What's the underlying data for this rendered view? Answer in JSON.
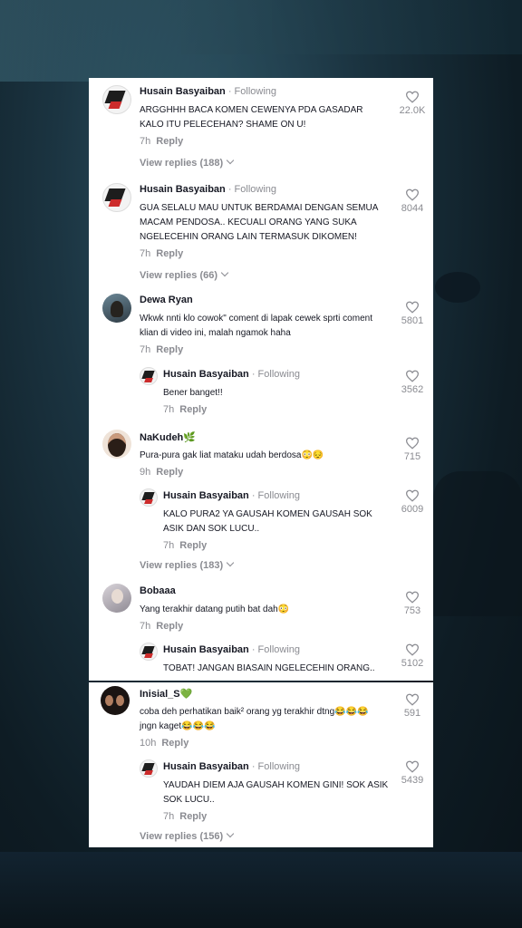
{
  "comments": [
    {
      "user": "Husain Basyaiban",
      "following": "· Following",
      "text": "ARGGHHH BACA KOMEN CEWENYA PDA GASADAR KALO ITU PELECEHAN? SHAME ON U!",
      "time": "7h",
      "reply": "Reply",
      "likes": "22.0K",
      "view_replies": "View replies (188)"
    },
    {
      "user": "Husain Basyaiban",
      "following": "· Following",
      "text": "GUA SELALU MAU UNTUK BERDAMAI DENGAN SEMUA MACAM PENDOSA.. KECUALI ORANG YANG SUKA NGELECEHIN ORANG LAIN TERMASUK DIKOMEN!",
      "time": "7h",
      "reply": "Reply",
      "likes": "8044",
      "view_replies": "View replies (66)"
    },
    {
      "user": "Dewa Ryan",
      "text": "Wkwk nnti klo cowok\" coment di lapak cewek sprti coment klian di video ini, malah ngamok haha",
      "time": "7h",
      "reply": "Reply",
      "likes": "5801",
      "sub": {
        "user": "Husain Basyaiban",
        "following": "· Following",
        "text": "Bener banget!!",
        "time": "7h",
        "reply": "Reply",
        "likes": "3562"
      }
    },
    {
      "user": "NaKudeh🌿",
      "text": "Pura-pura gak liat mataku udah berdosa😳😔",
      "time": "9h",
      "reply": "Reply",
      "likes": "715",
      "sub": {
        "user": "Husain Basyaiban",
        "following": "· Following",
        "text": "KALO PURA2 YA GAUSAH KOMEN GAUSAH SOK ASIK DAN SOK LUCU..",
        "time": "7h",
        "reply": "Reply",
        "likes": "6009"
      },
      "view_replies": "View replies (183)"
    },
    {
      "user": "Bobaaa",
      "text": "Yang terakhir datang putih bat dah😳",
      "time": "7h",
      "reply": "Reply",
      "likes": "753",
      "sub": {
        "user": "Husain Basyaiban",
        "following": "· Following",
        "text": "TOBAT! JANGAN BIASAIN NGELECEHIN ORANG..",
        "likes": "5102"
      }
    },
    {
      "user": "Inisial_S💚",
      "text": "coba deh perhatikan baik² orang yg terakhir dtng😂😂😂 jngn kaget😂😂😂",
      "time": "10h",
      "reply": "Reply",
      "likes": "591",
      "sub": {
        "user": "Husain Basyaiban",
        "following": "· Following",
        "text": "YAUDAH DIEM AJA GAUSAH KOMEN GINI! SOK ASIK SOK LUCU..",
        "time": "7h",
        "reply": "Reply",
        "likes": "5439"
      },
      "view_replies": "View replies (156)"
    }
  ]
}
